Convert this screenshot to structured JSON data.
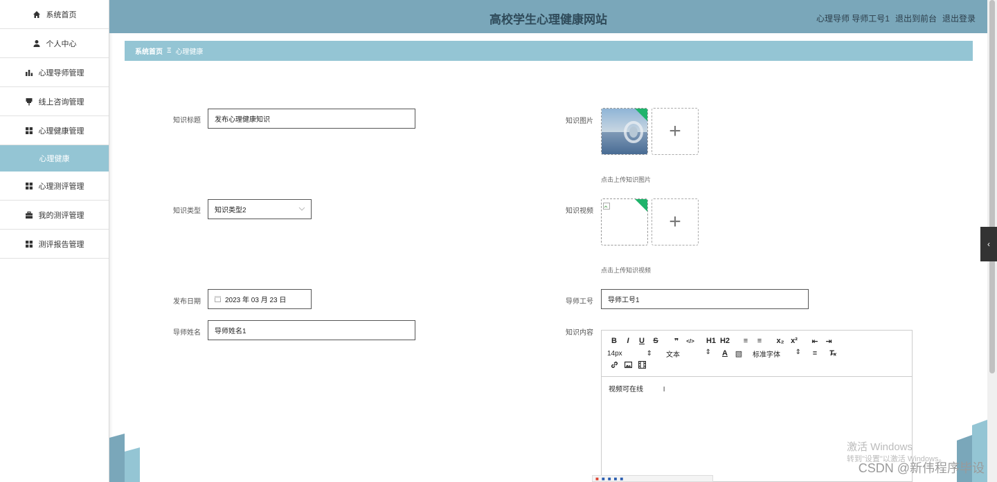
{
  "site": {
    "title": "高校学生心理健康网站"
  },
  "header": {
    "user": "心理导师 导师工号1",
    "to_front": "退出到前台",
    "logout": "退出登录"
  },
  "sidebar": {
    "items": [
      {
        "label": "系统首页",
        "icon": "home-icon"
      },
      {
        "label": "个人中心",
        "icon": "user-icon"
      },
      {
        "label": "心理导师管理",
        "icon": "bar-chart-icon"
      },
      {
        "label": "线上咨询管理",
        "icon": "pin-icon"
      },
      {
        "label": "心理健康管理",
        "icon": "grid-icon"
      }
    ],
    "sub_item": "心理健康",
    "items_after": [
      {
        "label": "心理测评管理",
        "icon": "grid-icon"
      },
      {
        "label": "我的测评管理",
        "icon": "briefcase-icon"
      },
      {
        "label": "测评报告管理",
        "icon": "grid-icon"
      }
    ]
  },
  "breadcrumb": {
    "home": "系统首页",
    "sep": "Ξ",
    "current": "心理健康"
  },
  "form": {
    "title_label": "知识标题",
    "title_value": "发布心理健康知识",
    "type_label": "知识类型",
    "type_value": "知识类型2",
    "date_label": "发布日期",
    "date_value": "2023 年 03 月 23 日",
    "name_label": "导师姓名",
    "name_value": "导师姓名1",
    "image_label": "知识图片",
    "image_hint": "点击上传知识图片",
    "video_label": "知识视频",
    "video_hint": "点击上传知识视频",
    "id_label": "导师工号",
    "id_value": "导师工号1",
    "content_label": "知识内容"
  },
  "editor": {
    "buttons_row1": [
      "B",
      "I",
      "U",
      "S",
      "❞",
      "</>",
      "H1",
      "H2",
      "≡",
      "≡",
      "x₂",
      "x²",
      "⇤",
      "⇥"
    ],
    "size": "14px",
    "block": "文本",
    "font": "标准字体",
    "content": "视频可在线"
  },
  "os": {
    "activate": "激活 Windows",
    "activate_sub": "转到\"设置\"以激活 Windows。",
    "watermark": "CSDN @新伟程序毕设"
  },
  "colors": {
    "topbar": "#7aa7ba",
    "accent": "#94c5d4",
    "corner": "#1fb36b"
  }
}
